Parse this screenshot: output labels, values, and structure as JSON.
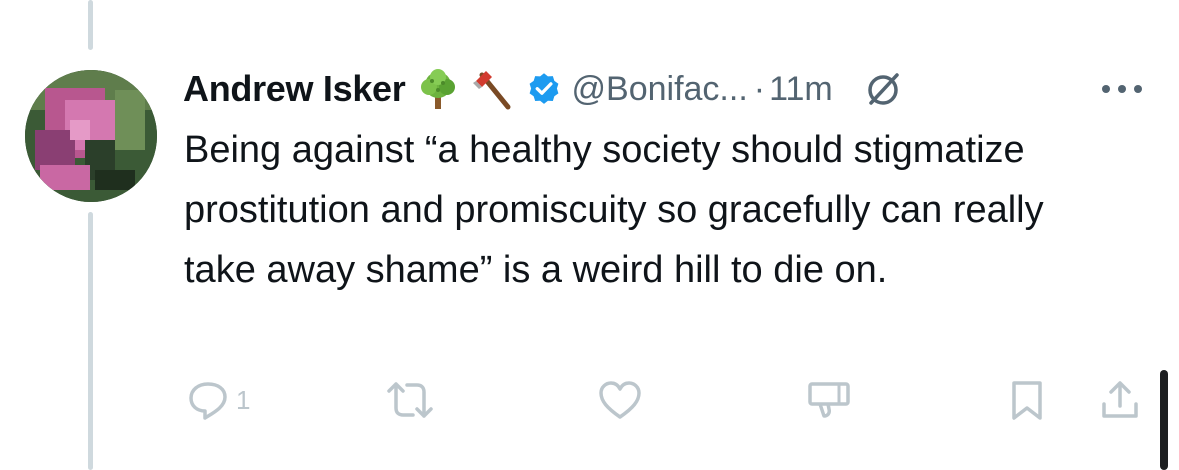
{
  "tweet": {
    "display_name": "Andrew Isker",
    "name_emojis": [
      "tree-emoji",
      "axe-emoji"
    ],
    "verified": true,
    "handle": "@Bonifac...",
    "separator": "·",
    "time": "11m",
    "text": "Being against “a healthy society should stigmatize prostitution and promiscuity so gracefully can really take away shame” is a weird hill to die on."
  },
  "actions": {
    "reply_count": "1"
  },
  "colors": {
    "text": "#0f1419",
    "secondary": "#536471",
    "verified": "#1d9bf0",
    "action_icon": "#bcc6cc",
    "thread_line": "#cfd9de"
  }
}
